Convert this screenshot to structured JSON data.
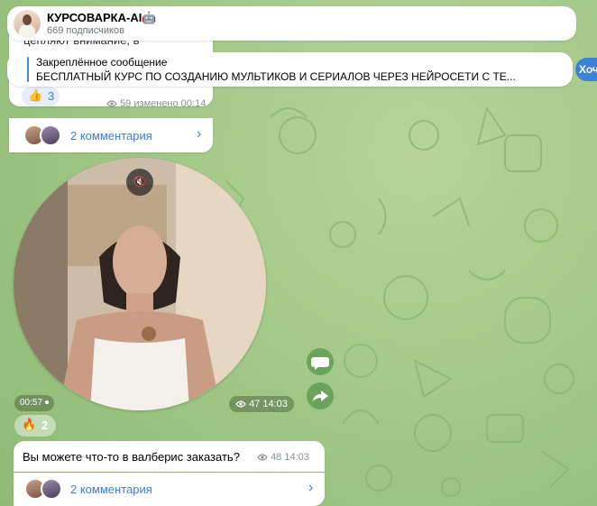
{
  "channel": {
    "name": "КУРСОВАРКА-AI🤖",
    "subscribers": "669 подписчиков"
  },
  "pinned": {
    "title": "Закреплённое сообщение",
    "text": "БЕСПЛАТНЫЙ КУРС ПО СОЗДАНИЮ МУЛЬТИКОВ И СЕРИАЛОВ ЧЕРЕЗ НЕЙРОСЕТИ С ТЕ...",
    "action_label": "Хоч"
  },
  "post1": {
    "text_fragment": "цепляют внимание, в",
    "reaction_emoji": "👍",
    "reaction_count": "3",
    "views": "59",
    "edited_time": "изменено 00:14",
    "comments": "2 комментария"
  },
  "video_post": {
    "duration": "00:57",
    "views": "47",
    "time": "14:03",
    "reaction_emoji": "🔥",
    "reaction_count": "2"
  },
  "post2": {
    "text": "Вы можете что-то в валберис заказать?",
    "views": "48",
    "time": "14:03",
    "comments": "2 комментария"
  },
  "icons": {
    "mute": "speaker-muted-icon",
    "comment": "comment-bubble-icon",
    "share": "share-arrow-icon",
    "views": "eye-icon",
    "chevron": "chevron-right-icon"
  },
  "colors": {
    "accent": "#3b7fd0",
    "wallpaper": "#a3c988",
    "side_button": "#6ba35d"
  }
}
